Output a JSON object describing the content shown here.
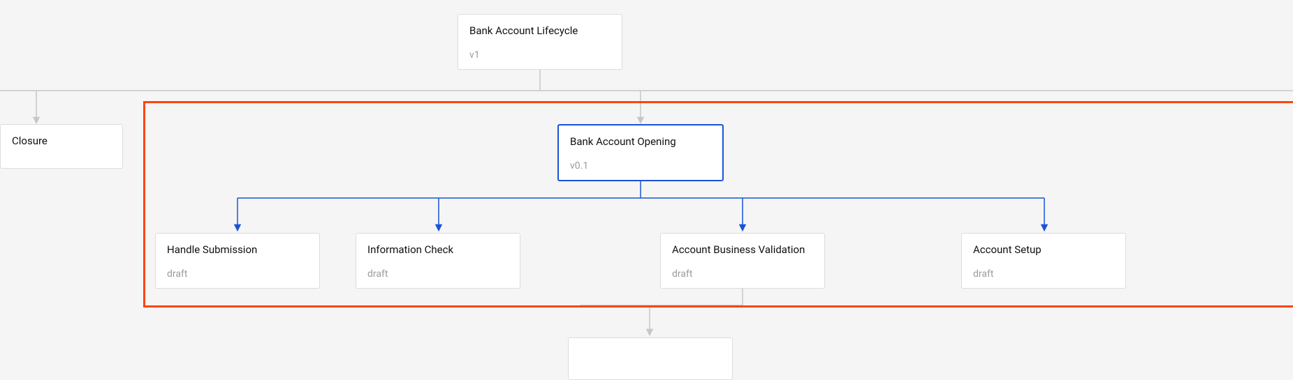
{
  "nodes": {
    "root": {
      "title": "Bank Account Lifecycle",
      "version": "v1"
    },
    "closure": {
      "title": "Closure",
      "version": ""
    },
    "opening": {
      "title": "Bank Account Opening",
      "version": "v0.1",
      "selected": true
    },
    "handle_submission": {
      "title": "Handle Submission",
      "version": "draft"
    },
    "information_check": {
      "title": "Information Check",
      "version": "draft"
    },
    "account_business_validation": {
      "title": "Account Business Validation",
      "version": "draft"
    },
    "account_setup": {
      "title": "Account Setup",
      "version": "draft"
    },
    "partial_bottom": {
      "title": ""
    }
  },
  "colors": {
    "selected_border": "#1a53d8",
    "default_border": "#dcdcdc",
    "highlight_box": "#ff4500",
    "blue_edge": "#1a53d8",
    "grey_edge": "#c7c7c7"
  }
}
